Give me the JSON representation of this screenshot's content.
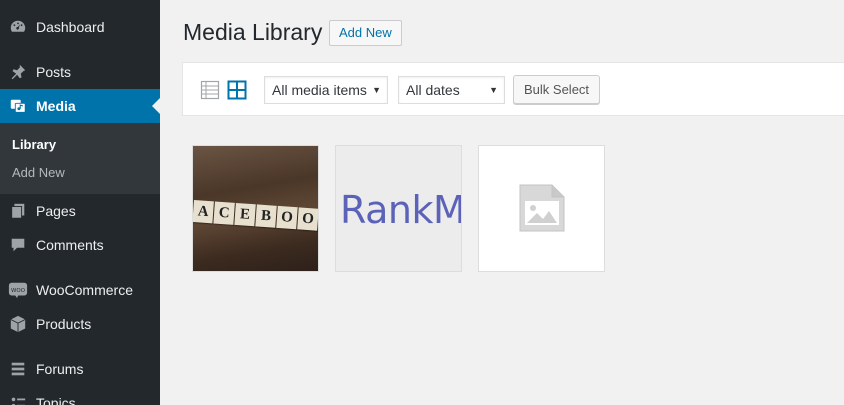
{
  "sidebar": {
    "items": [
      {
        "label": "Dashboard",
        "icon": "dashboard-icon"
      },
      {
        "label": "Posts",
        "icon": "pin-icon"
      },
      {
        "label": "Media",
        "icon": "media-icon",
        "active": true
      },
      {
        "label": "Pages",
        "icon": "pages-icon"
      },
      {
        "label": "Comments",
        "icon": "comment-icon"
      },
      {
        "label": "WooCommerce",
        "icon": "woocommerce-icon"
      },
      {
        "label": "Products",
        "icon": "box-icon"
      },
      {
        "label": "Forums",
        "icon": "forums-icon"
      },
      {
        "label": "Topics",
        "icon": "topics-icon"
      }
    ],
    "submenu": [
      {
        "label": "Library",
        "current": true
      },
      {
        "label": "Add New"
      }
    ],
    "woo_icon_text": "WOO"
  },
  "header": {
    "title": "Media Library",
    "add_new_label": "Add New"
  },
  "toolbar": {
    "view_modes": [
      "list-view-icon",
      "grid-view-icon"
    ],
    "active_view": "grid",
    "media_filter": "All media items",
    "date_filter": "All dates",
    "bulk_select_label": "Bulk Select"
  },
  "grid": {
    "items": [
      {
        "type": "image",
        "text": "ACEBOO"
      },
      {
        "type": "image",
        "text": "RankM"
      },
      {
        "type": "placeholder",
        "icon": "image-placeholder-icon"
      }
    ]
  },
  "colors": {
    "sidebar_bg": "#23282d",
    "active_bg": "#0073aa",
    "link": "#0073aa",
    "rank_purple": "#5b62b8"
  }
}
